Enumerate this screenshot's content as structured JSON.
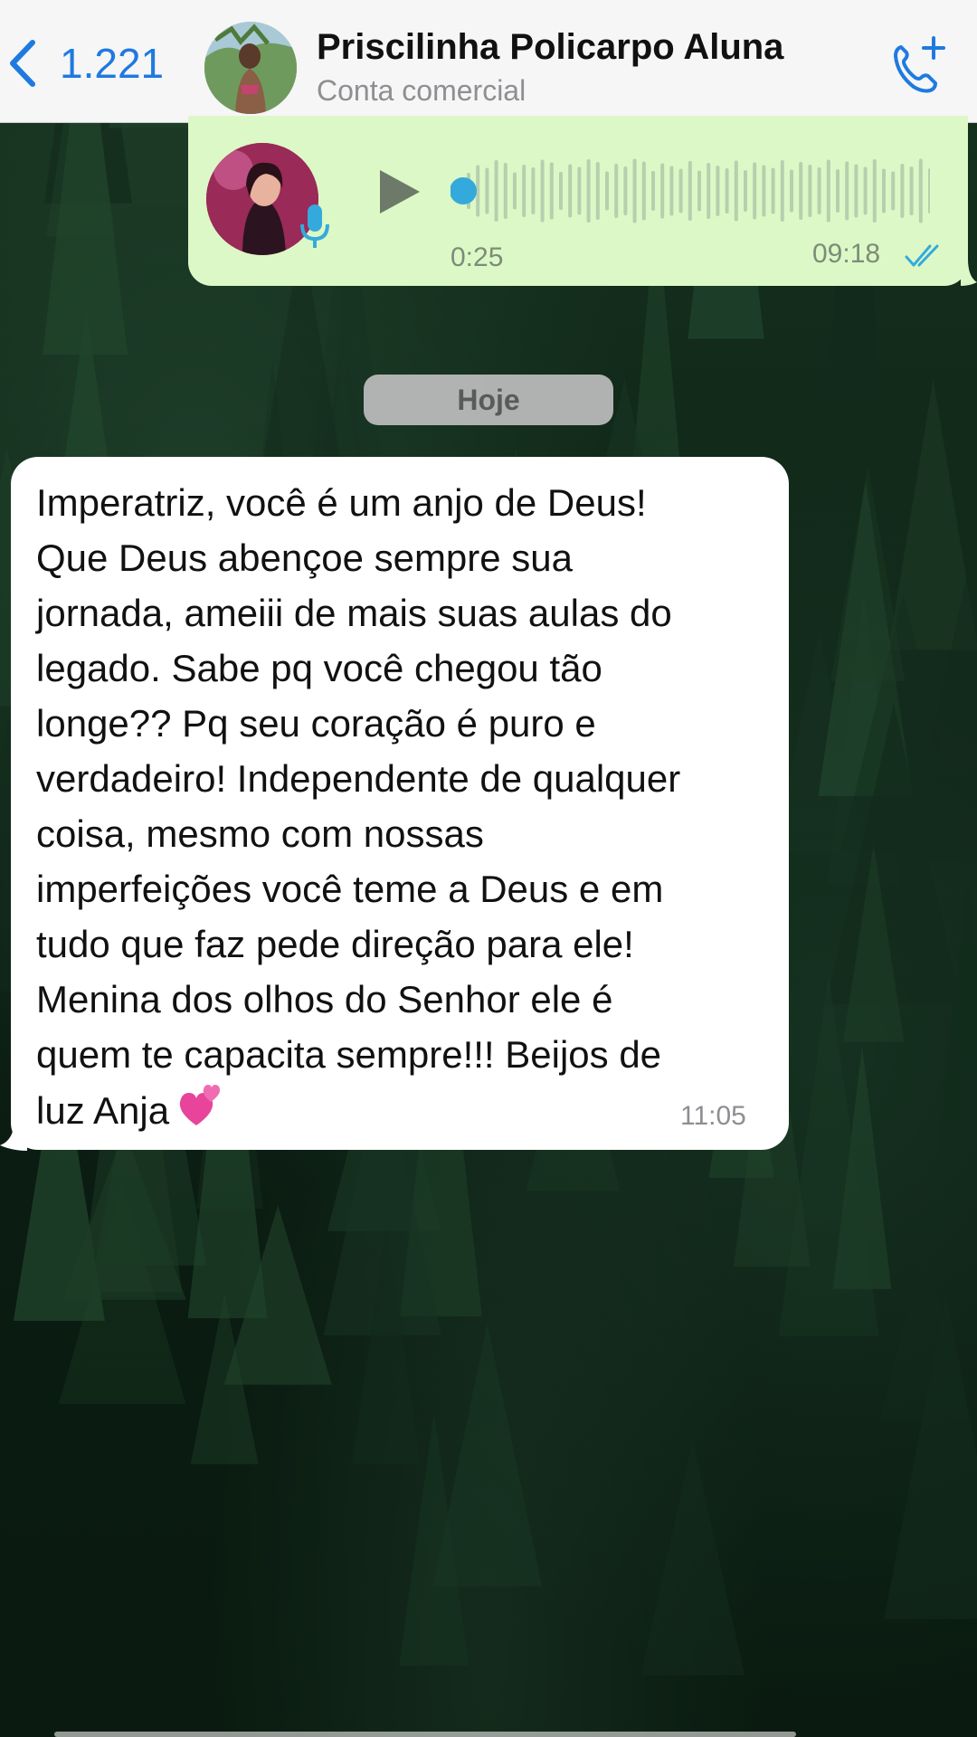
{
  "header": {
    "back_count": "1.221",
    "contact_name": "Priscilinha Policarpo Aluna",
    "contact_subtitle": "Conta comercial"
  },
  "voice_message": {
    "duration": "0:25",
    "time": "09:18",
    "status": "read",
    "progress": 0.0
  },
  "date_separator": "Hoje",
  "text_message": {
    "lines": [
      "Imperatriz, você é um anjo de Deus!",
      "Que Deus abençoe sempre sua",
      "jornada, ameiii de mais suas aulas do",
      "legado. Sabe pq você chegou tão",
      "longe?? Pq seu coração é puro e",
      "verdadeiro! Independente de qualquer",
      "coisa, mesmo com nossas",
      "imperfeições você teme a Deus e em",
      "tudo que faz pede direção para ele!",
      "Menina dos olhos do Senhor ele é",
      "quem te capacita sempre!!! Beijos de",
      "luz Anja"
    ],
    "emoji": "two-hearts-icon",
    "time": "11:05"
  },
  "colors": {
    "accent": "#1f7ae0",
    "outgoing_bubble": "#dcf8c6",
    "incoming_bubble": "#ffffff",
    "header_bg": "#f6f6f6",
    "voice_progress_dot": "#34aadc",
    "read_ticks": "#34aadc"
  }
}
